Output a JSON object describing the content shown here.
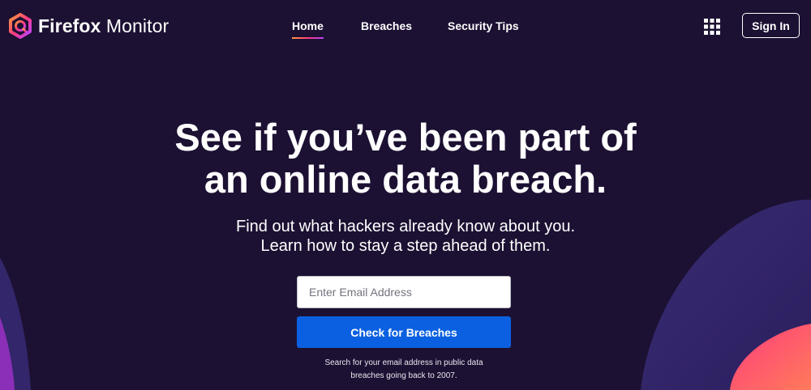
{
  "brand": {
    "bold": "Firefox",
    "light": "Monitor"
  },
  "nav": [
    {
      "label": "Home",
      "active": true
    },
    {
      "label": "Breaches",
      "active": false
    },
    {
      "label": "Security Tips",
      "active": false
    }
  ],
  "header": {
    "apps_icon": "grid-icon",
    "signin_label": "Sign In"
  },
  "hero": {
    "title_line1": "See if you’ve been part of",
    "title_line2": "an online data breach.",
    "subtitle_line1": "Find out what hackers already know about you.",
    "subtitle_line2": "Learn how to stay a step ahead of them."
  },
  "form": {
    "email_placeholder": "Enter Email Address",
    "email_value": "",
    "submit_label": "Check for Breaches",
    "note_line1": "Search for your email address in public data",
    "note_line2": "breaches going back to 2007."
  },
  "colors": {
    "background": "#1d1133",
    "accent_blue": "#0a60e0",
    "shape_purple": "#3a2a72",
    "shape_pink": "#ff3c7d",
    "shape_orange": "#ff8a3c"
  }
}
